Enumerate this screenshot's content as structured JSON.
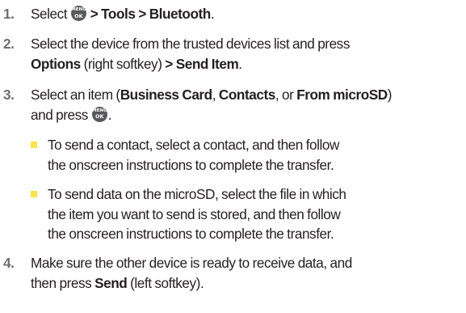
{
  "menu_key": {
    "icon": "menu-ok-key-icon",
    "line1": "MENU",
    "line2": "OK"
  },
  "colors": {
    "text": "#231f20",
    "step_number": "#6d6e71",
    "bullet": "#f7e34a",
    "key_fill": "#58595b"
  },
  "steps": [
    {
      "number": "1.",
      "select": "Select",
      "path1": "> Tools",
      "path2": "> Bluetooth",
      "period": "."
    },
    {
      "number": "2.",
      "line1": "Select the device from the trusted devices list and press",
      "options": "Options",
      "softkey": "(right softkey)",
      "send_item": "> Send Item",
      "period": "."
    },
    {
      "number": "3.",
      "intro": "Select an item (",
      "business_card": "Business Card",
      "comma1": ",",
      "contacts": "Contacts",
      "or": ", or",
      "from_microsd": "From microSD",
      "close_paren": ")",
      "and_press": "and press",
      "period": ".",
      "bullets": [
        {
          "line1": "To send a contact, select a contact, and then follow",
          "line2": "the onscreen instructions to complete the transfer."
        },
        {
          "line1": "To send data on the microSD, select the file in which",
          "line2": "the item you want to send is stored, and then follow",
          "line3": "the onscreen instructions to complete the transfer."
        }
      ]
    },
    {
      "number": "4.",
      "line1": "Make sure the other device is ready to receive data, and",
      "then_press": "then press",
      "send": "Send",
      "softkey": "(left softkey).",
      "period": ""
    }
  ]
}
